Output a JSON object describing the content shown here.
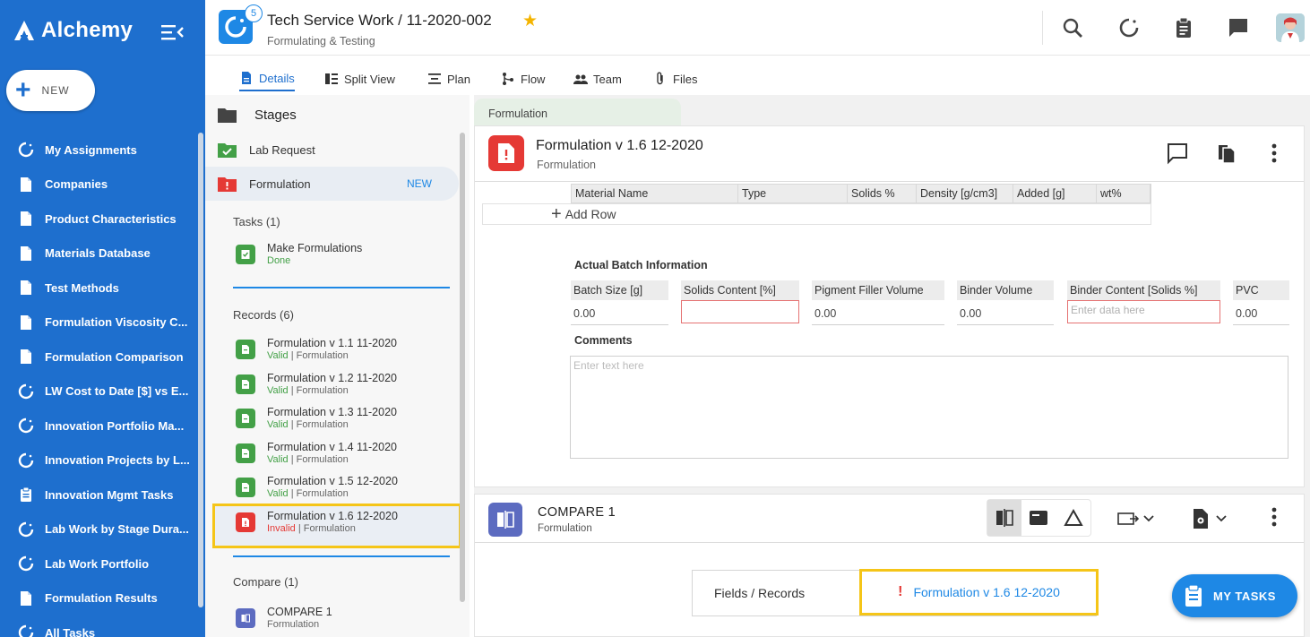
{
  "brand": {
    "name": "Alchemy"
  },
  "new_button": {
    "label": "NEW"
  },
  "nav": {
    "items": [
      {
        "label": "My Assignments",
        "icon": "loading-ring-icon"
      },
      {
        "label": "Companies",
        "icon": "document-icon"
      },
      {
        "label": "Product Characteristics",
        "icon": "document-icon"
      },
      {
        "label": "Materials Database",
        "icon": "document-icon"
      },
      {
        "label": "Test Methods",
        "icon": "document-icon"
      },
      {
        "label": "Formulation Viscosity C...",
        "icon": "document-icon"
      },
      {
        "label": "Formulation Comparison",
        "icon": "document-icon"
      },
      {
        "label": "LW Cost to Date [$] vs E...",
        "icon": "loading-ring-icon"
      },
      {
        "label": "Innovation Portfolio Ma...",
        "icon": "loading-ring-icon"
      },
      {
        "label": "Innovation Projects by L...",
        "icon": "loading-ring-icon"
      },
      {
        "label": "Innovation Mgmt Tasks",
        "icon": "clipboard-icon"
      },
      {
        "label": "Lab Work by Stage Dura...",
        "icon": "loading-ring-icon"
      },
      {
        "label": "Lab Work Portfolio",
        "icon": "loading-ring-icon"
      },
      {
        "label": "Formulation Results",
        "icon": "document-icon"
      },
      {
        "label": "All Tasks",
        "icon": "loading-ring-icon"
      }
    ]
  },
  "header": {
    "badge": "5",
    "title": "Tech Service Work / 11-2020-002",
    "subtitle": "Formulating & Testing",
    "accent": "#1e88e5",
    "star_color": "#f4b400"
  },
  "tabs": [
    {
      "label": "Details",
      "icon": "document-icon",
      "active": true
    },
    {
      "label": "Split View",
      "icon": "split-view-icon"
    },
    {
      "label": "Plan",
      "icon": "plan-icon"
    },
    {
      "label": "Flow",
      "icon": "flow-icon"
    },
    {
      "label": "Team",
      "icon": "team-icon"
    },
    {
      "label": "Files",
      "icon": "paperclip-icon"
    }
  ],
  "stages": {
    "title": "Stages",
    "items": [
      {
        "label": "Lab Request",
        "status": "complete"
      },
      {
        "label": "Formulation",
        "badge": "NEW",
        "status": "error"
      }
    ],
    "tasks_label": "Tasks (1)",
    "tasks": [
      {
        "title": "Make Formulations",
        "status": "Done"
      }
    ],
    "records_label": "Records (6)",
    "records": [
      {
        "title": "Formulation v 1.1 11-2020",
        "status": "Valid",
        "type": "| Formulation"
      },
      {
        "title": "Formulation v 1.2 11-2020",
        "status": "Valid",
        "type": "| Formulation"
      },
      {
        "title": "Formulation v 1.3 11-2020",
        "status": "Valid",
        "type": "| Formulation"
      },
      {
        "title": "Formulation v 1.4 11-2020",
        "status": "Valid",
        "type": "| Formulation"
      },
      {
        "title": "Formulation v 1.5 12-2020",
        "status": "Valid",
        "type": "| Formulation"
      },
      {
        "title": "Formulation v 1.6 12-2020",
        "status": "Invalid",
        "type": "| Formulation"
      }
    ],
    "compare_label": "Compare (1)",
    "compare": [
      {
        "title": "COMPARE 1",
        "sub": "Formulation"
      }
    ]
  },
  "main": {
    "crumb": "Formulation",
    "record": {
      "title": "Formulation v 1.6 12-2020",
      "subtitle": "Formulation"
    },
    "materials": {
      "columns": [
        "Material Name",
        "Type",
        "Solids %",
        "Density [g/cm3]",
        "Added [g]",
        "wt%"
      ],
      "add_row": "Add Row"
    },
    "batch": {
      "title": "Actual Batch Information",
      "fields": [
        {
          "label": "Batch Size [g]",
          "value": "0.00"
        },
        {
          "label": "Solids Content [%]",
          "value": ""
        },
        {
          "label": "Pigment Filler Volume",
          "value": "0.00"
        },
        {
          "label": "Binder Volume",
          "value": "0.00"
        },
        {
          "label": "Binder Content [Solids %]",
          "placeholder": "Enter data here"
        },
        {
          "label": "PVC",
          "value": "0.00"
        }
      ]
    },
    "comments": {
      "label": "Comments",
      "placeholder": "Enter text here"
    },
    "compare": {
      "title": "COMPARE 1",
      "subtitle": "Formulation",
      "fields_records_label": "Fields / Records",
      "record_link": "Formulation v 1.6 12-2020"
    }
  },
  "my_tasks": {
    "label": "MY TASKS"
  }
}
